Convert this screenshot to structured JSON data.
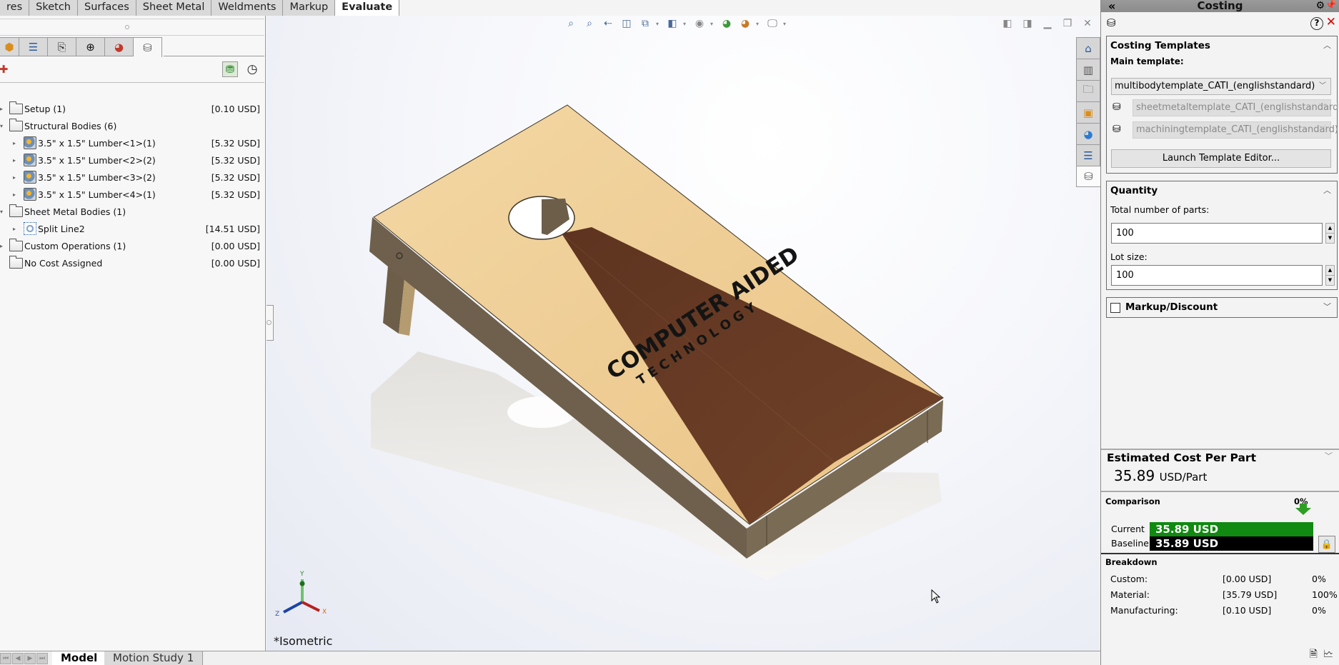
{
  "command_tabs": [
    {
      "label": "res",
      "active": false
    },
    {
      "label": "Sketch",
      "active": false
    },
    {
      "label": "Surfaces",
      "active": false
    },
    {
      "label": "Sheet Metal",
      "active": false
    },
    {
      "label": "Weldments",
      "active": false
    },
    {
      "label": "Markup",
      "active": false
    },
    {
      "label": "Evaluate",
      "active": true
    }
  ],
  "manager_tabs": [
    {
      "icon": "feature-manager-icon",
      "glyph": "⬢"
    },
    {
      "icon": "property-manager-icon",
      "glyph": "☰"
    },
    {
      "icon": "configuration-manager-icon",
      "glyph": "⎘"
    },
    {
      "icon": "dimxpert-manager-icon",
      "glyph": "⊕"
    },
    {
      "icon": "display-manager-icon",
      "glyph": "◕"
    },
    {
      "icon": "costing-manager-icon",
      "glyph": "⛁",
      "active": true
    }
  ],
  "tree": [
    {
      "level": 0,
      "expander": "▸",
      "type": "folder",
      "label": "Setup (1)",
      "cost": "[0.10 USD]"
    },
    {
      "level": 0,
      "expander": "▾",
      "type": "folder",
      "label": "Structural Bodies (6)",
      "cost": ""
    },
    {
      "level": 1,
      "expander": "▸",
      "type": "body",
      "label": "3.5\" x 1.5\" Lumber<1>(1)",
      "cost": "[5.32 USD]"
    },
    {
      "level": 1,
      "expander": "▸",
      "type": "body",
      "label": "3.5\" x 1.5\" Lumber<2>(2)",
      "cost": "[5.32 USD]"
    },
    {
      "level": 1,
      "expander": "▸",
      "type": "body",
      "label": "3.5\" x 1.5\" Lumber<3>(2)",
      "cost": "[5.32 USD]"
    },
    {
      "level": 1,
      "expander": "▸",
      "type": "body",
      "label": "3.5\" x 1.5\" Lumber<4>(1)",
      "cost": "[5.32 USD]"
    },
    {
      "level": 0,
      "expander": "▾",
      "type": "folder",
      "label": "Sheet Metal Bodies (1)",
      "cost": ""
    },
    {
      "level": 1,
      "expander": "▸",
      "type": "sheetmetal",
      "label": "Split Line2",
      "cost": "[14.51 USD]"
    },
    {
      "level": 0,
      "expander": "▸",
      "type": "folder",
      "label": "Custom Operations (1)",
      "cost": "[0.00 USD]"
    },
    {
      "level": 0,
      "expander": "",
      "type": "folder",
      "label": "No Cost Assigned",
      "cost": "[0.00 USD]"
    }
  ],
  "viewport": {
    "view_name": "*Isometric",
    "model_text_line1": "COMPUTER AIDED",
    "model_text_line2": "T E C H N O L O G Y",
    "triad": {
      "x": "X",
      "y": "Y",
      "z": "Z"
    },
    "colors": {
      "light_wood": "#f0cf96",
      "dark_wood": "#6b3e24",
      "frame": "#6e604d"
    }
  },
  "task_pane_icons": [
    "home-icon",
    "design-library-icon",
    "file-explorer-icon",
    "view-palette-icon",
    "appearances-icon",
    "custom-properties-icon",
    "costing-icon"
  ],
  "costing": {
    "title": "Costing",
    "templates": {
      "header": "Costing Templates",
      "main_label": "Main template:",
      "main_value": "multibodytemplate_CATI_(englishstandard)",
      "sheetmetal_value": "sheetmetaltemplate_CATI_(englishstandard)",
      "machining_value": "machiningtemplate_CATI_(englishstandard)",
      "launch_button": "Launch Template Editor..."
    },
    "quantity": {
      "header": "Quantity",
      "total_label": "Total number of parts:",
      "total_value": "100",
      "lot_label": "Lot size:",
      "lot_value": "100"
    },
    "markup": {
      "header": "Markup/Discount",
      "checked": false
    },
    "estimate": {
      "header": "Estimated Cost Per Part",
      "value": "35.89",
      "unit": "USD/Part"
    },
    "comparison": {
      "header": "Comparison",
      "percent": "0%",
      "current_label": "Current",
      "current_value": "35.89 USD",
      "current_color": "#108a10",
      "baseline_label": "Baseline",
      "baseline_value": "35.89 USD",
      "baseline_color": "#000000"
    },
    "breakdown": {
      "header": "Breakdown",
      "rows": [
        {
          "label": "Custom:",
          "value": "[0.00 USD]",
          "percent": "0%"
        },
        {
          "label": "Material:",
          "value": "[35.79 USD]",
          "percent": "100%"
        },
        {
          "label": "Manufacturing:",
          "value": "[0.10 USD]",
          "percent": "0%"
        }
      ]
    }
  },
  "bottom_tabs": [
    {
      "label": "Model",
      "active": true
    },
    {
      "label": "Motion Study 1",
      "active": false
    }
  ]
}
